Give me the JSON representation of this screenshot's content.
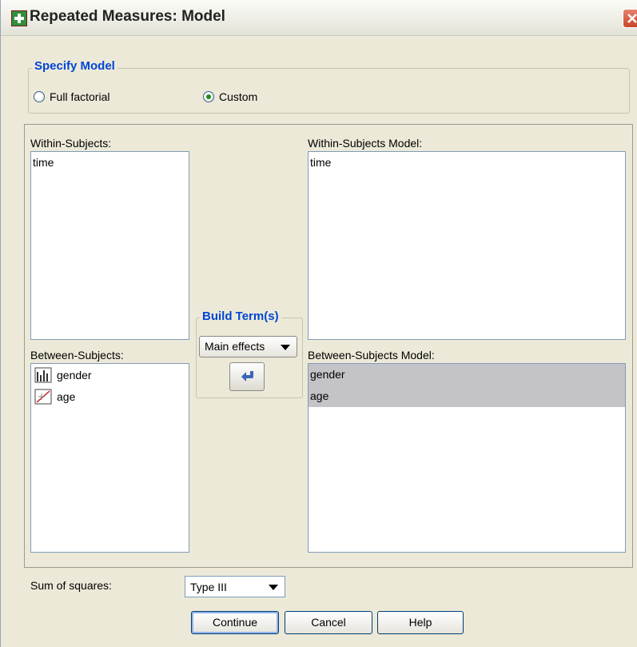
{
  "window": {
    "title": "Repeated Measures: Model"
  },
  "specify_model": {
    "legend": "Specify Model",
    "full_factorial_label": "Full factorial",
    "custom_label": "Custom",
    "selected": "Custom"
  },
  "within_subjects": {
    "label": "Within-Subjects:",
    "items": [
      "time"
    ]
  },
  "between_subjects": {
    "label": "Between-Subjects:",
    "items": [
      {
        "name": "gender",
        "icon": "nominal-variable-icon"
      },
      {
        "name": "age",
        "icon": "scale-variable-icon"
      }
    ]
  },
  "within_subjects_model": {
    "label": "Within-Subjects Model:",
    "items": [
      "time"
    ]
  },
  "between_subjects_model": {
    "label": "Between-Subjects Model:",
    "items": [
      "gender",
      "age"
    ]
  },
  "build_terms": {
    "legend": "Build Term(s)",
    "type_value": "Main effects"
  },
  "sum_of_squares": {
    "label": "Sum of squares:",
    "value": "Type III"
  },
  "buttons": {
    "continue": "Continue",
    "cancel": "Cancel",
    "help": "Help"
  }
}
